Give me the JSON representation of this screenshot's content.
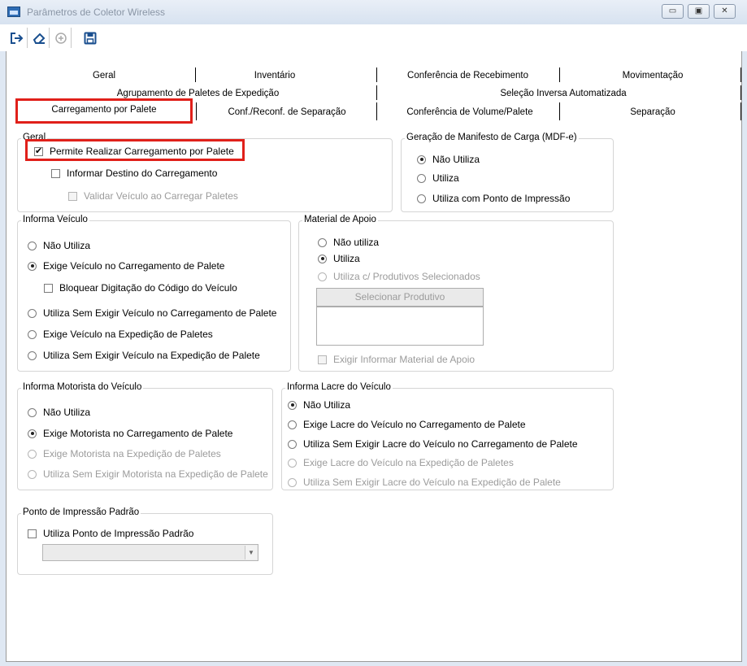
{
  "window": {
    "title": "Parâmetros de Coletor Wireless",
    "minimize_glyph": "▭",
    "maximize_glyph": "▣",
    "close_glyph": "✕"
  },
  "toolbar": {
    "icons": [
      "exit-icon",
      "eraser-icon",
      "add-icon",
      "save-icon"
    ]
  },
  "tabs": {
    "row1": [
      "Geral",
      "Inventário",
      "Conferência de Recebimento",
      "Movimentação"
    ],
    "row2": [
      "Agrupamento de Paletes de Expedição",
      "Seleção Inversa Automatizada"
    ],
    "row3": [
      "Carregamento por Palete",
      "Conf./Reconf. de Separação",
      "Conferência de Volume/Palete",
      "Separação"
    ],
    "active": "Carregamento por Palete"
  },
  "highlight_color": "#e0201a",
  "geral": {
    "label": "Geral",
    "permite": {
      "label": "Permite Realizar Carregamento por Palete",
      "checked": true
    },
    "informar": {
      "label": "Informar Destino do Carregamento",
      "checked": false
    },
    "validar": {
      "label": "Validar Veículo ao Carregar Paletes",
      "checked": false,
      "disabled": true
    }
  },
  "mdfe": {
    "label": "Geração de Manifesto de Carga (MDF-e)",
    "options": [
      "Não Utiliza",
      "Utiliza",
      "Utiliza com Ponto de Impressão"
    ],
    "selected": "Não Utiliza"
  },
  "veiculo": {
    "label": "Informa Veículo",
    "options": [
      "Não Utiliza",
      "Exige Veículo no Carregamento de Palete",
      "Utiliza Sem Exigir Veículo no Carregamento de Palete",
      "Exige Veículo na Expedição de Paletes",
      "Utiliza Sem Exigir Veículo na Expedição de Palete"
    ],
    "selected": "Exige Veículo no Carregamento de Palete",
    "bloquear": {
      "label": "Bloquear Digitação do Código do Veículo",
      "checked": false
    }
  },
  "material": {
    "label": "Material de Apoio",
    "options": [
      "Não utiliza",
      "Utiliza",
      "Utiliza c/ Produtivos Selecionados"
    ],
    "selected": "Utiliza",
    "button": "Selecionar Produtivo",
    "exigir": {
      "label": "Exigir Informar Material de Apoio",
      "checked": false,
      "disabled": true
    }
  },
  "motorista": {
    "label": "Informa Motorista do Veículo",
    "options": [
      "Não Utiliza",
      "Exige Motorista no Carregamento de Palete",
      "Exige Motorista na Expedição de Paletes",
      "Utiliza Sem Exigir Motorista na Expedição de Palete"
    ],
    "selected": "Exige Motorista no Carregamento de Palete"
  },
  "lacre": {
    "label": "Informa Lacre do Veículo",
    "options": [
      "Não Utiliza",
      "Exige Lacre do Veículo no Carregamento de Palete",
      "Utiliza Sem Exigir Lacre do Veículo no Carregamento de Palete",
      "Exige Lacre do Veículo na Expedição de Paletes",
      "Utiliza Sem Exigir Lacre do Veículo na Expedição de Palete"
    ],
    "selected": "Não Utiliza"
  },
  "ponto": {
    "label": "Ponto de Impressão Padrão",
    "check": {
      "label": "Utiliza Ponto de Impressão Padrão",
      "checked": false
    },
    "combo_value": ""
  }
}
